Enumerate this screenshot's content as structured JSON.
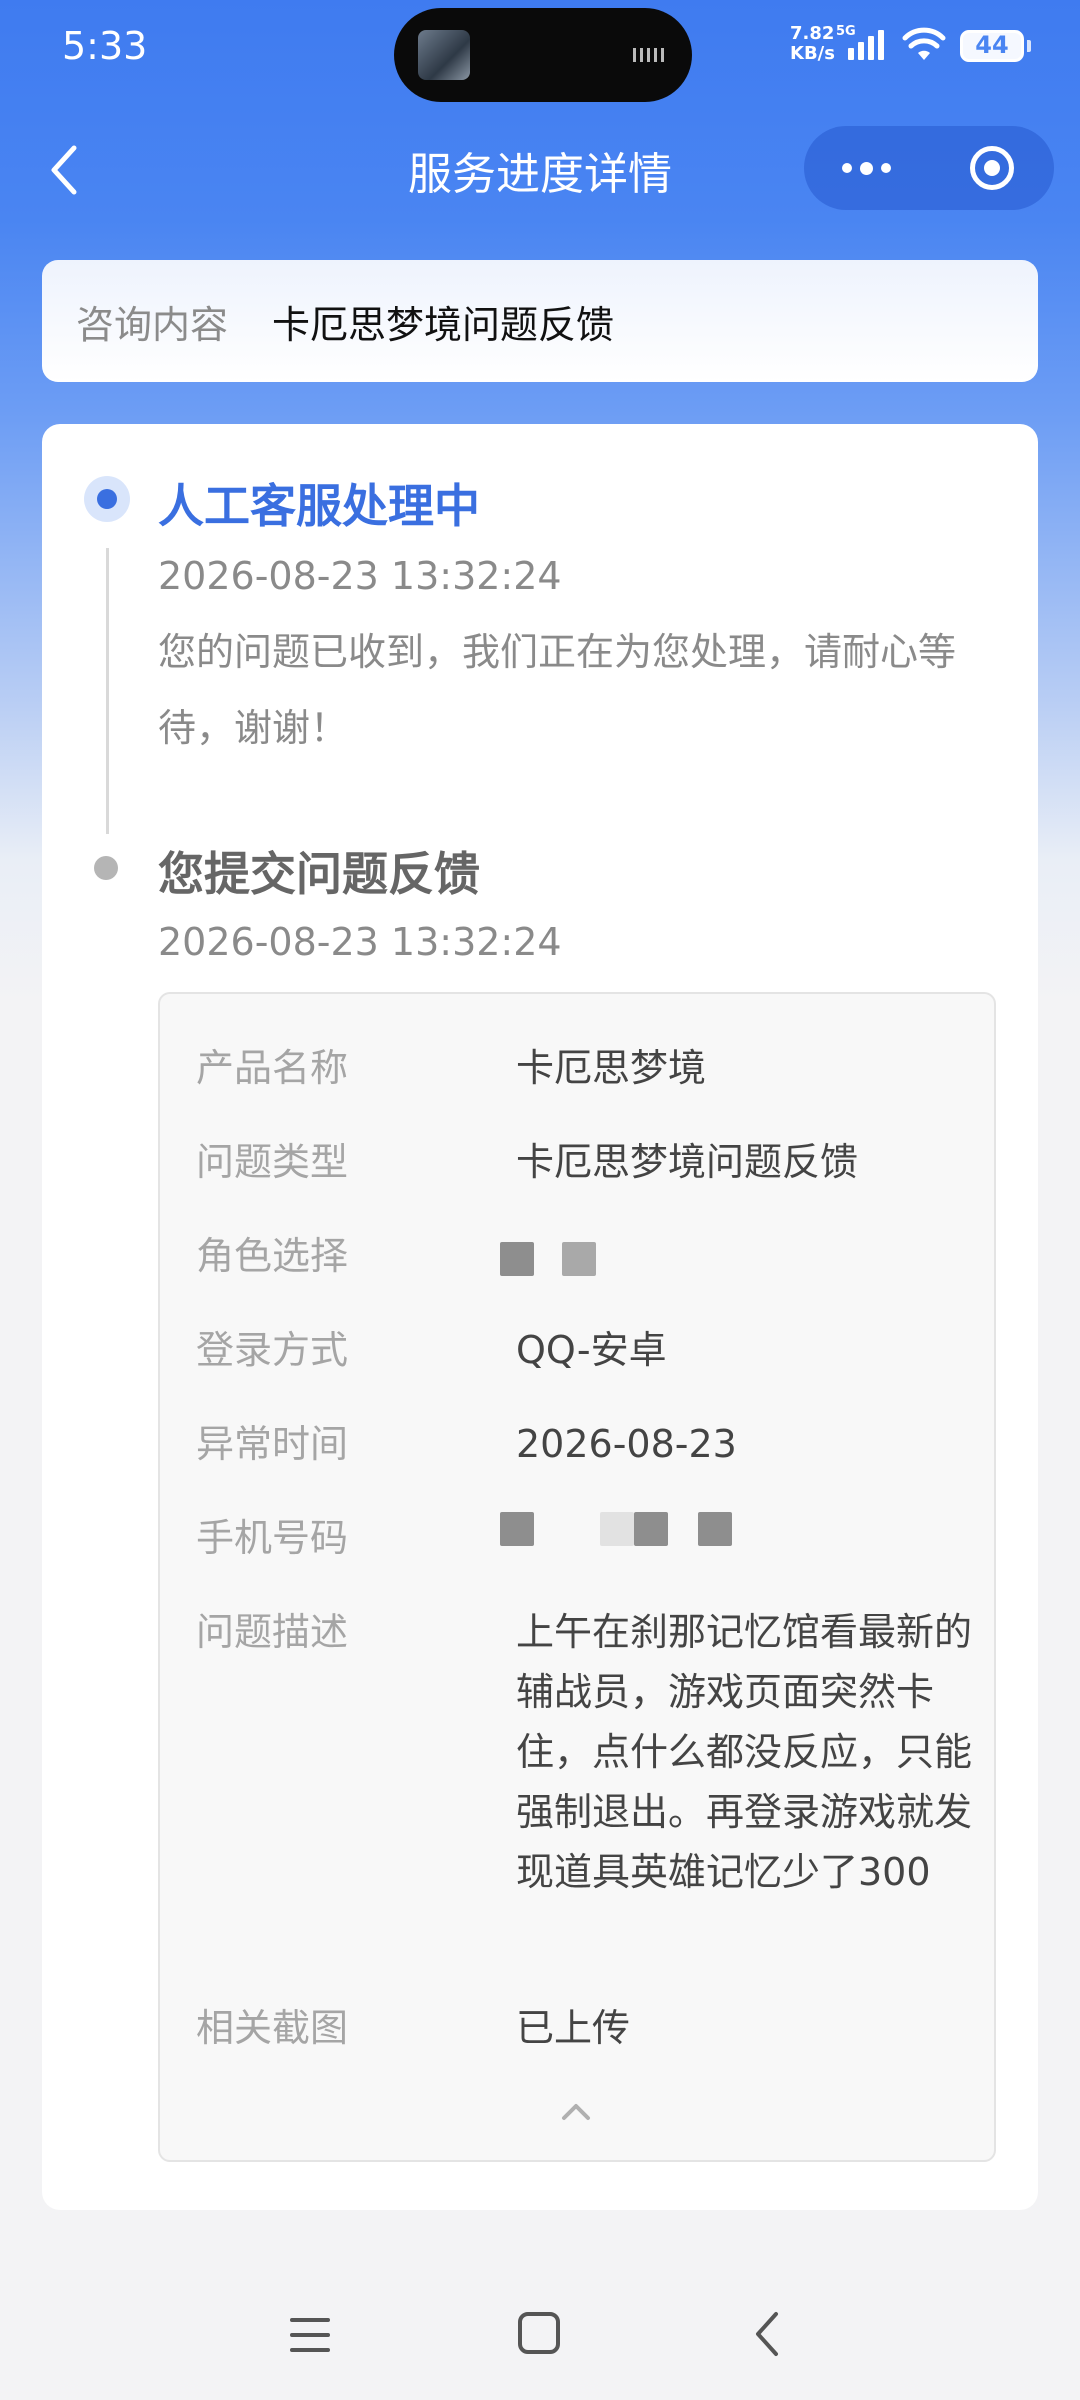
{
  "status_bar": {
    "time": "5:33",
    "net_speed_top": "7.82",
    "net_speed_bottom": "KB/s",
    "network_type": "5G",
    "battery": "44"
  },
  "nav": {
    "title": "服务进度详情",
    "back_icon": "chevron-left-icon",
    "more_icon": "more-dots-icon",
    "close_icon": "target-circle-icon"
  },
  "consult": {
    "label": "咨询内容",
    "value": "卡厄思梦境问题反馈"
  },
  "timeline": [
    {
      "title": "人工客服处理中",
      "time": "2026-08-23 13:32:24",
      "desc": "您的问题已收到，我们正在为您处理，请耐心等待，谢谢！",
      "active": true
    },
    {
      "title": "您提交问题反馈",
      "time": "2026-08-23 13:32:24",
      "active": false
    }
  ],
  "details": {
    "product": {
      "label": "产品名称",
      "value": "卡厄思梦境"
    },
    "type": {
      "label": "问题类型",
      "value": "卡厄思梦境问题反馈"
    },
    "role": {
      "label": "角色选择"
    },
    "login": {
      "label": "登录方式",
      "value": "QQ-安卓"
    },
    "time": {
      "label": "异常时间",
      "value": "2026-08-23"
    },
    "phone": {
      "label": "手机号码"
    },
    "desc": {
      "label": "问题描述",
      "value": "上午在刹那记忆馆看最新的辅战员，游戏页面突然卡住，点什么都没反应，只能强制退出。再登录游戏就发现道具英雄记忆少了300"
    },
    "screenshot": {
      "label": "相关截图",
      "value": "已上传"
    }
  },
  "colors": {
    "accent": "#3a6fe0",
    "header_gradient_top": "#3f7bf0",
    "background": "#f3f3f5"
  }
}
